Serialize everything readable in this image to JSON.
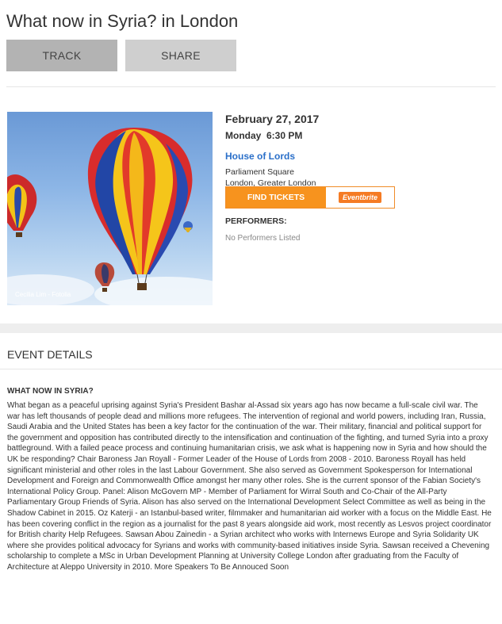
{
  "page": {
    "title": "What now in Syria? in London"
  },
  "actions": {
    "track_label": "TRACK",
    "share_label": "SHARE"
  },
  "image": {
    "credit": "Cecilia Lim - Fotolia"
  },
  "event": {
    "date": "February 27, 2017",
    "time": "Monday  6:30 PM",
    "venue": "House of Lords",
    "address_line1": "Parliament Square",
    "address_line2": "London, Greater London"
  },
  "tickets": {
    "label": "FIND TICKETS",
    "provider": "Eventbrite"
  },
  "performers": {
    "heading": "PERFORMERS:",
    "value": "No Performers Listed"
  },
  "details": {
    "heading": "EVENT DETAILS",
    "subheading": "WHAT NOW IN SYRIA?",
    "body": "What began as a peaceful uprising against Syria's President Bashar al-Assad six years ago has now became a full-scale civil war. The war has left thousands of people dead and millions more refugees. The intervention of regional and world powers, including Iran, Russia, Saudi Arabia and the United States has been a key factor for the continuation of the war. Their military, financial and political support for the government and opposition has contributed directly to the intensification and continuation of the fighting, and turned Syria into a proxy battleground. With a failed peace process and continuing humanitarian crisis, we ask what is happening now in Syria and how should the UK be responding? Chair Baroness Jan Royall  -  Former Leader of the House of Lords from 2008 - 2010. Baroness Royall has held significant ministerial and other roles in the last Labour Government. She also served as Government Spokesperson for International Development and Foreign and Commonwealth Office amongst her many other roles. She is the current sponsor of the Fabian Society's International Policy Group.  Panel: Alison McGovern MP - Member of Parliament for Wirral South and Co-Chair of the All-Party Parliamentary Group Friends of Syria. Alison has also served on the International Development Select Committee as well as being in the Shadow Cabinet in 2015.  Oz Katerji - an Istanbul-based writer, filmmaker and humanitarian aid worker with a focus on the Middle East. He has been covering conflict in the region as a journalist for the past 8 years alongside aid work, most recently as Lesvos project coordinator for British charity Help Refugees.  Sawsan Abou Zainedin - a Syrian architect who works with Internews Europe and Syria Solidarity UK where she provides political advocacy for Syrians and works with community-based initiatives inside Syria. Sawsan received a Chevening scholarship to complete a MSc in Urban Development Planning at University College London after graduating from the Faculty of Architecture at Aleppo University in 2010.  More Speakers To Be Annouced Soon"
  },
  "colors": {
    "accent_orange": "#f7931e",
    "link_blue": "#2a6fc9",
    "button_gray": "#cfcfcf"
  }
}
